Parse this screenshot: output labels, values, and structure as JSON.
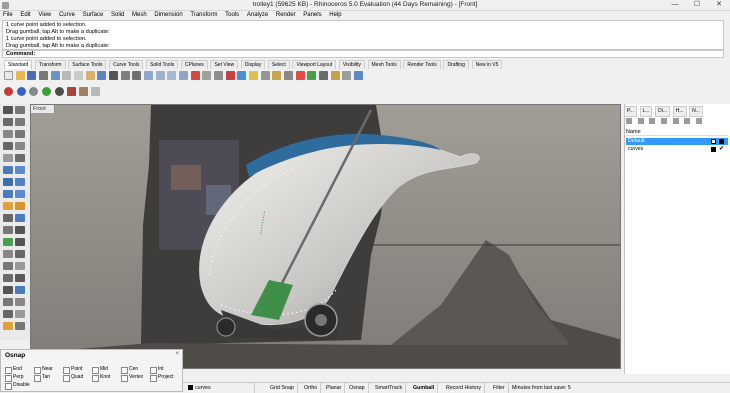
{
  "window": {
    "title": "trolley1 (59625 KB) - Rhinoceros 5.0 Evaluation (44 Days Remaining) - [Front]",
    "controls": {
      "minimize": "—",
      "maximize": "☐",
      "close": "✕"
    }
  },
  "menu": [
    "File",
    "Edit",
    "View",
    "Curve",
    "Surface",
    "Solid",
    "Mesh",
    "Dimension",
    "Transform",
    "Tools",
    "Analyze",
    "Render",
    "Panels",
    "Help"
  ],
  "command_history": [
    "1 curve point added to selection.",
    "Drag gumball, tap Alt to make a duplicate:",
    "1 curve point added to selection.",
    "Drag gumball, tap Alt to make a duplicate:"
  ],
  "command_prompt": "Command:",
  "toolbar_tabs": [
    "Standard",
    "Transform",
    "Surface Tools",
    "Curve Tools",
    "Solid Tools",
    "CPlanes",
    "Set View",
    "Display",
    "Select",
    "Viewport Layout",
    "Visibility",
    "Mesh Tools",
    "Render Tools",
    "Drafting",
    "New in V5"
  ],
  "active_toolbar_tab": "Standard",
  "viewport": {
    "label": "Front"
  },
  "panel": {
    "tabs": [
      "P...",
      "L...",
      "Di...",
      "H...",
      "N..."
    ],
    "column_header": "Name",
    "layers": [
      {
        "name": "Default",
        "color": "#000000",
        "current": false
      },
      {
        "name": "curves",
        "color": "#000000",
        "current": true
      }
    ]
  },
  "osnap": {
    "title": "Osnap",
    "close": "×",
    "items": [
      "End",
      "Near",
      "Point",
      "Mid",
      "Cen",
      "Int",
      "Perp",
      "Tan",
      "Quad",
      "Knot",
      "Vertex",
      "Project"
    ],
    "disable_label": "Disable"
  },
  "statusbar": {
    "layer": "curves",
    "items": [
      "Grid Snap",
      "Ortho",
      "Planar",
      "Osnap",
      "SmartTrack",
      "Gumball",
      "Record History",
      "Filter"
    ],
    "active": "Gumball",
    "autosave": "Minutes from last save: 5"
  },
  "colors": {
    "accent": "#3399ff",
    "viewport_bg": "#8e8b87",
    "trolley_blue": "#2f6c9e",
    "broom_green": "#3f8f4a"
  }
}
